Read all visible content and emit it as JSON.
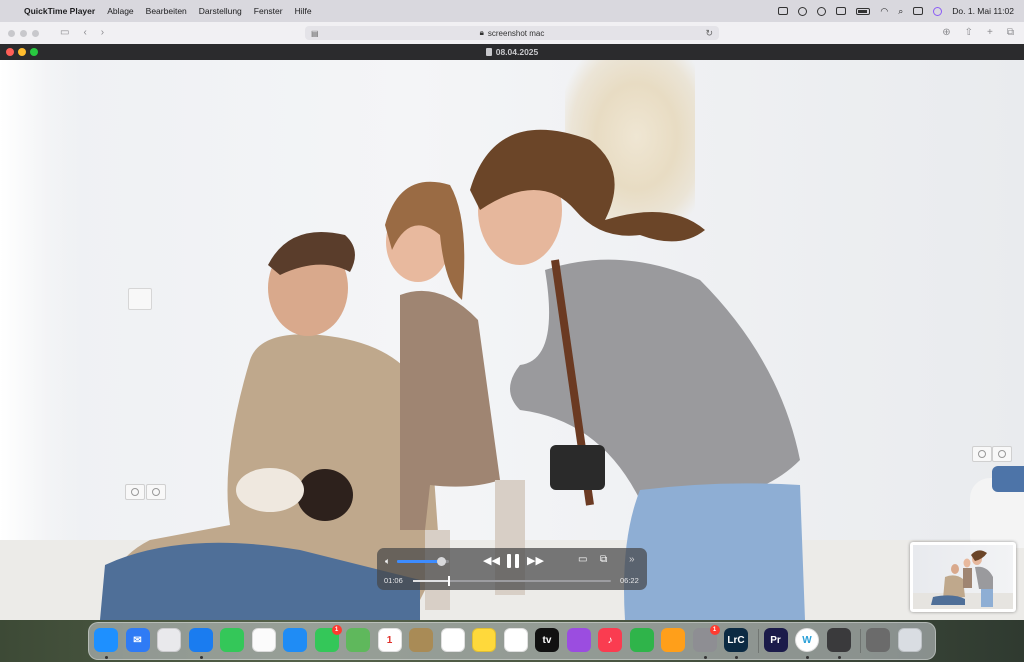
{
  "menubar": {
    "apple": "",
    "app_name": "QuickTime Player",
    "menus": [
      "Ablage",
      "Bearbeiten",
      "Darstellung",
      "Fenster",
      "Hilfe"
    ],
    "clock": "Do. 1. Mai  11:02"
  },
  "browser": {
    "url": "screenshot mac"
  },
  "player": {
    "window_title": "08.04.2025",
    "elapsed": "01:06",
    "remaining": "06:22",
    "volume_level": 0.85,
    "progress_fraction": 0.18
  },
  "dock": {
    "apps": [
      {
        "name": "Finder",
        "label": "",
        "color": "#1e90ff",
        "running": true
      },
      {
        "name": "Mail",
        "label": "✉",
        "color": "#2f7bf5",
        "running": false
      },
      {
        "name": "Launchpad",
        "label": "",
        "color": "#e9e9ec",
        "running": false
      },
      {
        "name": "Safari",
        "label": "",
        "color": "#1a7cf0",
        "running": true
      },
      {
        "name": "Messages",
        "label": "",
        "color": "#34c759",
        "running": false
      },
      {
        "name": "Photos",
        "label": "",
        "color": "#fbfbfb",
        "running": false
      },
      {
        "name": "Keynote",
        "label": "",
        "color": "#1f8cf5",
        "running": false
      },
      {
        "name": "FaceTime",
        "label": "",
        "color": "#34c759",
        "running": false,
        "badge": "1"
      },
      {
        "name": "Maps",
        "label": "",
        "color": "#5fb85c",
        "running": false
      },
      {
        "name": "Calendar",
        "label": "1",
        "color": "#ffffff",
        "running": false
      },
      {
        "name": "Notes-Brown",
        "label": "",
        "color": "#a98b56",
        "running": false
      },
      {
        "name": "Reminders",
        "label": "",
        "color": "#ffffff",
        "running": false
      },
      {
        "name": "Notes",
        "label": "",
        "color": "#ffd93b",
        "running": false
      },
      {
        "name": "Freeform",
        "label": "",
        "color": "#ffffff",
        "running": false
      },
      {
        "name": "TV",
        "label": "tv",
        "color": "#111111",
        "running": false
      },
      {
        "name": "Podcasts",
        "label": "",
        "color": "#9b4de0",
        "running": false
      },
      {
        "name": "Music",
        "label": "♪",
        "color": "#fa3c50",
        "running": false
      },
      {
        "name": "Numbers",
        "label": "",
        "color": "#2fb44a",
        "running": false
      },
      {
        "name": "Pages",
        "label": "",
        "color": "#ff9f1a",
        "running": false
      },
      {
        "name": "System Settings",
        "label": "",
        "color": "#8e8e93",
        "running": true,
        "badge": "1"
      },
      {
        "name": "Lightroom Classic",
        "label": "LrC",
        "color": "#0b2a43",
        "running": true
      },
      {
        "name": "Premiere Pro",
        "label": "Pr",
        "color": "#1b1b4a",
        "running": false
      },
      {
        "name": "Word-W",
        "label": "W",
        "color": "#ffffff",
        "running": true
      },
      {
        "name": "QuickTime Player",
        "label": "",
        "color": "#3a3a3c",
        "running": true
      },
      {
        "name": "Recent-Document",
        "label": "",
        "color": "#6b6b6b",
        "running": false
      },
      {
        "name": "Trash",
        "label": "",
        "color": "#d9dde2",
        "running": false
      }
    ]
  }
}
